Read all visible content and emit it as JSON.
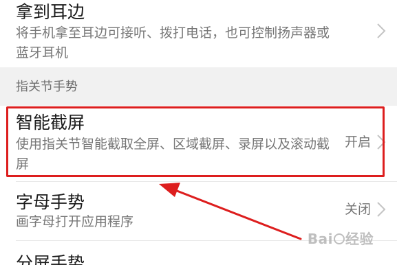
{
  "settings": {
    "raise_to_ear": {
      "title": "拿到耳边",
      "description": "将手机拿至耳边可接听、拨打电话，也可控制扬声器或蓝牙耳机"
    },
    "section_header": "指关节手势",
    "smart_screenshot": {
      "title": "智能截屏",
      "description": "使用指关节智能截取全屏、区域截屏、录屏以及滚动截屏",
      "value": "开启"
    },
    "letter_gesture": {
      "title": "字母手势",
      "description": "画字母打开应用程序",
      "value": "关闭"
    },
    "split_screen_gesture": {
      "title": "分屏手势"
    }
  },
  "annotation": {
    "highlight_color": "#dd1e1e",
    "arrow_color": "#dd1e1e"
  },
  "watermark": {
    "prefix": "Bai",
    "suffix": "经验"
  },
  "icons": {
    "chevron": "chevron-right-icon"
  },
  "colors": {
    "background": "#ffffff",
    "section_background": "#f1f1f1",
    "title_text": "#1b1b1b",
    "secondary_text": "#777777",
    "chevron": "#c4c4c4"
  }
}
